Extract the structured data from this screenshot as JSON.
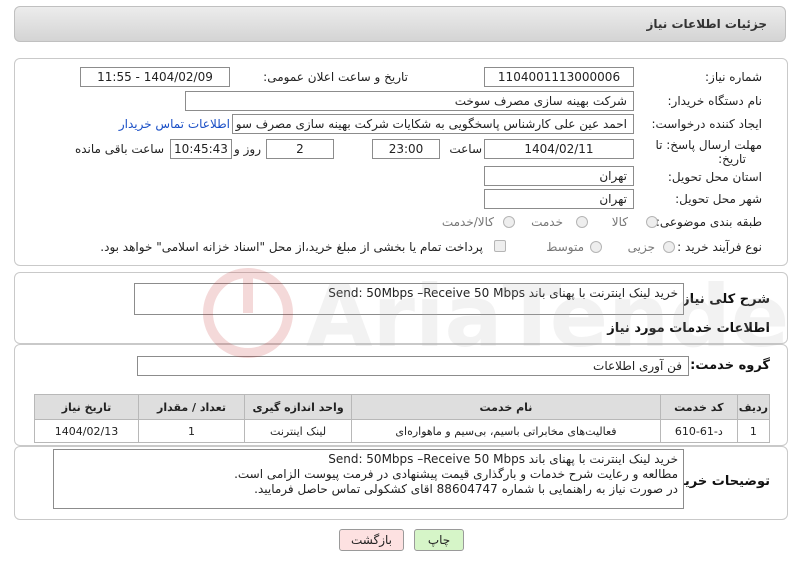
{
  "header": {
    "title": "جزئیات اطلاعات نیاز"
  },
  "form": {
    "need_number_label": "شماره نیاز:",
    "need_number": "1104001113000006",
    "announce_label": "تاریخ و ساعت اعلان عمومی:",
    "announce_value": "1404/02/09 - 11:55",
    "buyer_org_label": "نام دستگاه خریدار:",
    "buyer_org": "شرکت بهینه سازی مصرف سوخت",
    "creator_label": "ایجاد کننده درخواست:",
    "creator": "احمد عین علی کارشناس پاسخگویی به شکایات شرکت بهینه سازی مصرف سو",
    "contact_link": "اطلاعات تماس خریدار",
    "deadline_label": "مهلت ارسال پاسخ: تا",
    "deadline_label2": "تاریخ:",
    "deadline_date": "1404/02/11",
    "time_label": "ساعت",
    "deadline_time": "23:00",
    "days_value": "2",
    "days_label": "روز و",
    "remaining_time": "10:45:43",
    "remaining_label": "ساعت باقی مانده",
    "province_label": "استان محل تحویل:",
    "province": "تهران",
    "city_label": "شهر محل تحویل:",
    "city": "تهران",
    "category_label": "طبقه بندی موضوعی:",
    "category_options": [
      "کالا",
      "خدمت",
      "کالا/خدمت"
    ],
    "process_label": "نوع فرآیند خرید :",
    "process_options": [
      "جزیی",
      "متوسط"
    ],
    "payment_note": "پرداخت تمام یا بخشی از مبلغ خرید،از محل \"اسناد خزانه اسلامی\" خواهد بود."
  },
  "summary": {
    "label": "شرح کلی نیاز:",
    "text": "خرید لینک اینترنت با پهنای باند Send: 50Mbps –Receive 50 Mbps"
  },
  "services": {
    "section_title": "اطلاعات خدمات مورد نیاز",
    "group_label": "گروه خدمت:",
    "group_value": "فن آوری اطلاعات",
    "columns": [
      "ردیف",
      "کد خدمت",
      "نام خدمت",
      "واحد اندازه گیری",
      "تعداد / مقدار",
      "تاریخ نیاز"
    ],
    "rows": [
      [
        "1",
        "د-61-610",
        "فعالیت‌های مخابراتی باسیم، بی‌سیم و ماهواره‌ای",
        "لینک اینترنت",
        "1",
        "1404/02/13"
      ]
    ]
  },
  "buyer_notes": {
    "label": "توضیحات خریدار:",
    "lines": [
      "خرید لینک اینترنت با پهنای باند Send: 50Mbps –Receive 50 Mbps",
      "مطالعه و رعایت شرح خدمات و بارگذاری قیمت پیشنهادی در فرمت پیوست الزامی است.",
      "در صورت نیاز به راهنمایی با شماره 88604747 اقای کشکولی تماس حاصل فرمایید."
    ]
  },
  "buttons": {
    "print": "چاپ",
    "back": "بازگشت"
  },
  "colors": {
    "print_bg": "#d6f5c8",
    "back_bg": "#fde1e1",
    "link": "#1a4fc6"
  },
  "watermark": {
    "text": "AriaTender.neT"
  }
}
